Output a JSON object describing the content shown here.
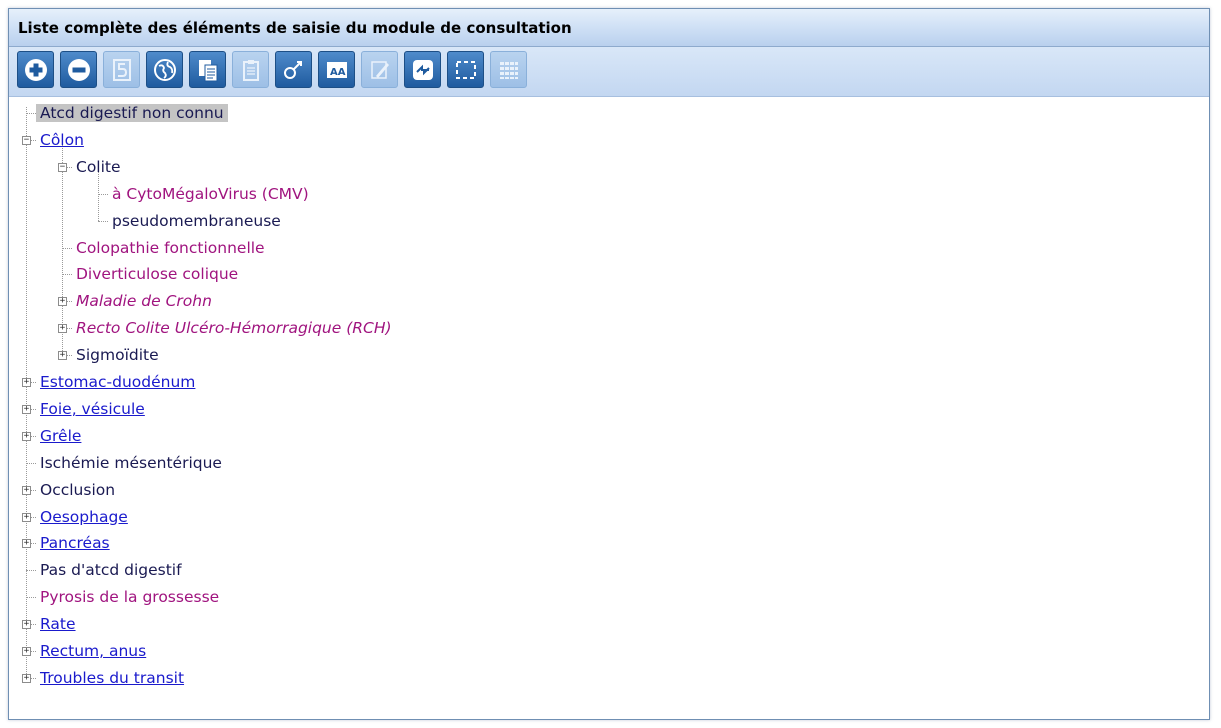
{
  "window": {
    "title": "Liste complète des éléments de saisie du module de consultation"
  },
  "toolbar": {
    "buttons": [
      {
        "icon": "plus-circle-icon",
        "enabled": true
      },
      {
        "icon": "minus-circle-icon",
        "enabled": true
      },
      {
        "icon": "number-five-icon",
        "enabled": false
      },
      {
        "icon": "globe-refresh-icon",
        "enabled": true
      },
      {
        "icon": "copy-documents-icon",
        "enabled": true
      },
      {
        "icon": "clipboard-paste-icon",
        "enabled": false
      },
      {
        "icon": "pin-branch-icon",
        "enabled": true
      },
      {
        "icon": "font-aa-icon",
        "enabled": true
      },
      {
        "icon": "edit-pencil-icon",
        "enabled": false
      },
      {
        "icon": "link-swap-icon",
        "enabled": true
      },
      {
        "icon": "dashed-selection-icon",
        "enabled": true
      },
      {
        "icon": "grid-table-icon",
        "enabled": false
      }
    ]
  },
  "tree": {
    "items": [
      {
        "label": "Atcd digestif non connu",
        "level": 0,
        "style": "plain",
        "selected": true,
        "has_children": false
      },
      {
        "label": "Côlon",
        "level": 0,
        "style": "link",
        "has_children": true,
        "expanded": true
      },
      {
        "label": "Colite",
        "level": 1,
        "style": "plain",
        "has_children": true,
        "expanded": true
      },
      {
        "label": "à CytoMégaloVirus (CMV)",
        "level": 2,
        "style": "magenta",
        "has_children": false
      },
      {
        "label": "pseudomembraneuse",
        "level": 2,
        "style": "plain",
        "has_children": false
      },
      {
        "label": "Colopathie fonctionnelle",
        "level": 1,
        "style": "magenta",
        "has_children": false
      },
      {
        "label": "Diverticulose colique",
        "level": 1,
        "style": "magenta",
        "has_children": false
      },
      {
        "label": "Maladie de Crohn",
        "level": 1,
        "style": "magenta-italic",
        "has_children": true,
        "expanded": false
      },
      {
        "label": "Recto Colite Ulcéro-Hémorragique (RCH)",
        "level": 1,
        "style": "magenta-italic",
        "has_children": true,
        "expanded": false
      },
      {
        "label": "Sigmoïdite",
        "level": 1,
        "style": "plain",
        "has_children": true,
        "expanded": false
      },
      {
        "label": "Estomac-duodénum",
        "level": 0,
        "style": "link",
        "has_children": true,
        "expanded": false
      },
      {
        "label": "Foie, vésicule",
        "level": 0,
        "style": "link",
        "has_children": true,
        "expanded": false
      },
      {
        "label": "Grêle",
        "level": 0,
        "style": "link",
        "has_children": true,
        "expanded": false
      },
      {
        "label": "Ischémie mésentérique",
        "level": 0,
        "style": "plain",
        "has_children": false
      },
      {
        "label": "Occlusion",
        "level": 0,
        "style": "plain",
        "has_children": true,
        "expanded": false
      },
      {
        "label": "Oesophage",
        "level": 0,
        "style": "link",
        "has_children": true,
        "expanded": false
      },
      {
        "label": "Pancréas",
        "level": 0,
        "style": "link",
        "has_children": true,
        "expanded": false
      },
      {
        "label": "Pas d'atcd digestif",
        "level": 0,
        "style": "plain",
        "has_children": false
      },
      {
        "label": "Pyrosis de la grossesse",
        "level": 0,
        "style": "magenta",
        "has_children": false
      },
      {
        "label": "Rate",
        "level": 0,
        "style": "link",
        "has_children": true,
        "expanded": false
      },
      {
        "label": "Rectum, anus",
        "level": 0,
        "style": "link",
        "has_children": true,
        "expanded": false
      },
      {
        "label": "Troubles du transit",
        "level": 0,
        "style": "link",
        "has_children": true,
        "expanded": false
      }
    ]
  }
}
